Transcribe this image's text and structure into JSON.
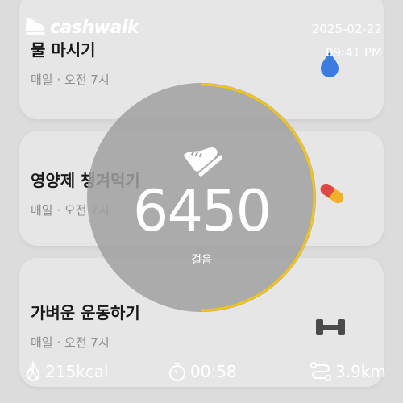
{
  "app": {
    "brand": "cashwalk"
  },
  "status": {
    "date": "2025-02-22",
    "time": "09:41 PM"
  },
  "tasks": [
    {
      "title": "물 마시기",
      "schedule": "매일 · 오전 7시",
      "icon": "water-drop-icon",
      "color": "#3c7be0"
    },
    {
      "title": "영양제 챙겨먹기",
      "schedule": "매일 · 오전 7시",
      "icon": "pill-icon",
      "color": "#e04848"
    },
    {
      "title": "가벼운 운동하기",
      "schedule": "매일 · 오전 7시",
      "icon": "dumbbell-icon",
      "color": "#4a4a4a"
    }
  ],
  "steps": {
    "value": "6450",
    "label": "걸음",
    "ring_color": "#f0c419"
  },
  "stats": {
    "calories": "215kcal",
    "duration": "00:58",
    "distance": "3.9km"
  }
}
